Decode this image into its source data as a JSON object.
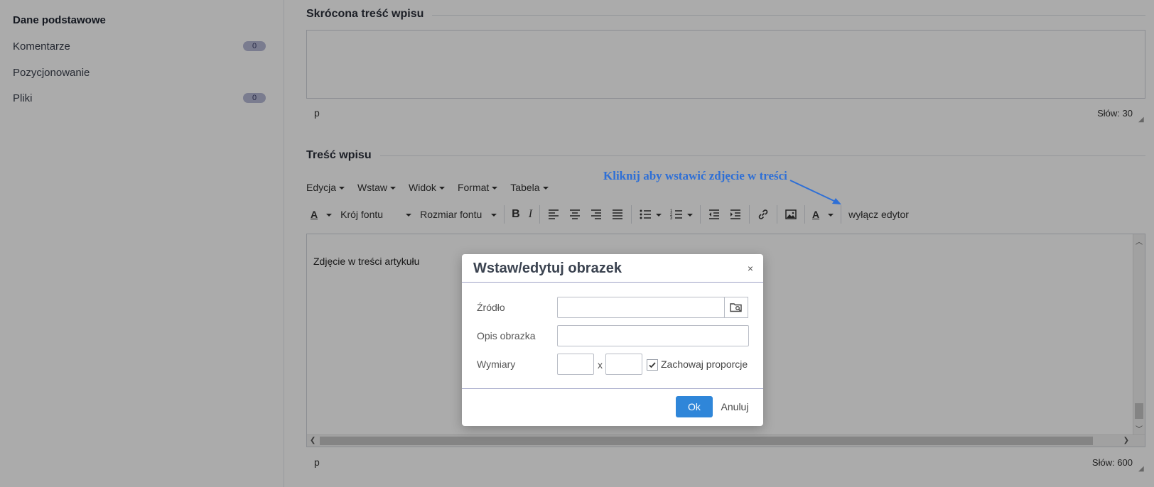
{
  "sidebar": {
    "items": [
      {
        "label": "Dane podstawowe"
      },
      {
        "label": "Komentarze",
        "badge": "0"
      },
      {
        "label": "Pozycjonowanie"
      },
      {
        "label": "Pliki",
        "badge": "0"
      }
    ]
  },
  "short_content": {
    "title": "Skrócona treść wpisu",
    "status_path": "p",
    "word_count": "Słów: 30"
  },
  "content": {
    "title": "Treść wpisu",
    "menu": [
      "Edycja",
      "Wstaw",
      "Widok",
      "Format",
      "Tabela"
    ],
    "font_family_label": "Krój fontu",
    "font_size_label": "Rozmiar fontu",
    "disable_editor_label": "wyłącz edytor",
    "body_text": "Zdjęcie w treści artykułu",
    "status_path": "p",
    "word_count": "Słów: 600"
  },
  "annotation": {
    "text": "Kliknij aby wstawić zdjęcie w treści",
    "color": "#2e6fd6"
  },
  "dialog": {
    "title": "Wstaw/edytuj obrazek",
    "close": "×",
    "source_label": "Źródło",
    "source_value": "",
    "alt_label": "Opis obrazka",
    "alt_value": "",
    "dimensions_label": "Wymiary",
    "width_value": "",
    "height_value": "",
    "dimension_separator": "x",
    "keep_ratio_label": "Zachowaj proporcje",
    "keep_ratio_checked": true,
    "ok_label": "Ok",
    "cancel_label": "Anuluj"
  },
  "colors": {
    "primary_button": "#2f86d9",
    "badge_bg": "#b7b9d6"
  }
}
